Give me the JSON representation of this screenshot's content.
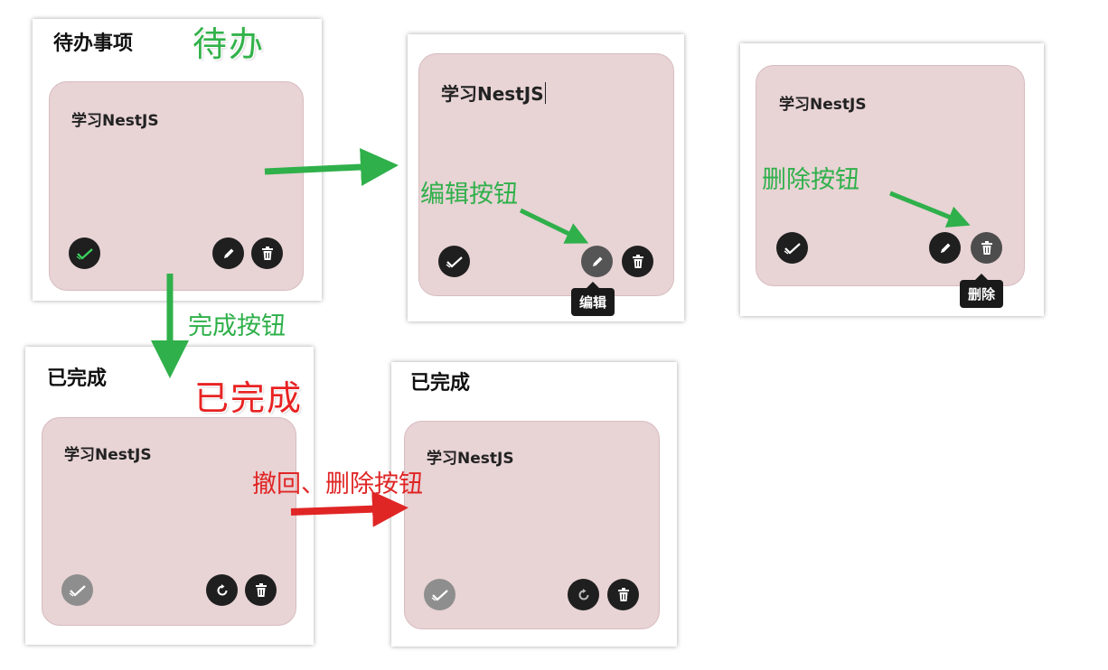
{
  "panels": {
    "todo": {
      "title": "待办事项",
      "card_text": "学习NestJS"
    },
    "edit": {
      "card_text": "学习NestJS",
      "tooltip": "编辑"
    },
    "delete": {
      "card_text": "学习NestJS",
      "tooltip": "删除"
    },
    "done_a": {
      "title": "已完成",
      "card_text": "学习NestJS"
    },
    "done_b": {
      "title": "已完成",
      "card_text": "学习NestJS"
    }
  },
  "annotations": {
    "todo_label": "待办",
    "done_label": "已完成",
    "edit_button": "编辑按钮",
    "delete_button": "删除按钮",
    "complete_button": "完成按钮",
    "undo_delete_buttons": "撤回、删除按钮"
  },
  "colors": {
    "card_bg": "#e8d3d5",
    "button_bg": "#1f1f1f",
    "disabled_button_bg": "#8e8e8e",
    "annotation_green": "#2fb04a",
    "annotation_red": "#e02525"
  },
  "icons": [
    "check-icon",
    "pencil-icon",
    "trash-icon",
    "undo-icon"
  ]
}
